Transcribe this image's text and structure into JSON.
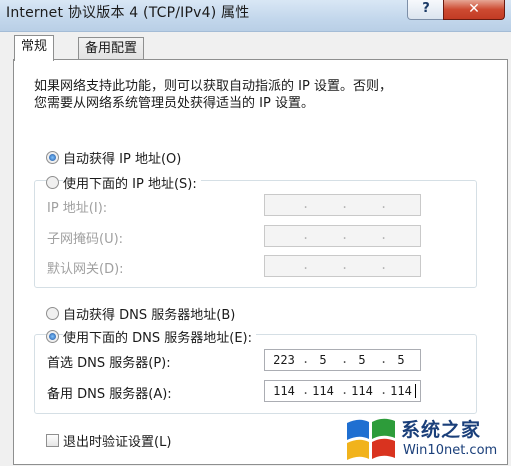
{
  "window": {
    "title": "Internet 协议版本 4 (TCP/IPv4) 属性",
    "help_label": "?",
    "close_label": "✕"
  },
  "tabs": [
    {
      "label": "常规",
      "active": true
    },
    {
      "label": "备用配置",
      "active": false
    }
  ],
  "description": {
    "line1": "如果网络支持此功能，则可以获取自动指派的 IP 设置。否则，",
    "line2": "您需要从网络系统管理员处获得适当的 IP 设置。"
  },
  "ip_section": {
    "auto_label": "自动获得 IP 地址(O)",
    "auto_selected": true,
    "manual_label": "使用下面的 IP 地址(S):",
    "manual_selected": false,
    "fields": [
      {
        "label": "IP 地址(I):"
      },
      {
        "label": "子网掩码(U):"
      },
      {
        "label": "默认网关(D):"
      }
    ]
  },
  "dns_section": {
    "auto_label": "自动获得 DNS 服务器地址(B)",
    "auto_selected": false,
    "manual_label": "使用下面的 DNS 服务器地址(E):",
    "manual_selected": true,
    "preferred": {
      "label": "首选 DNS 服务器(P):",
      "octets": [
        "223",
        "5",
        "5",
        "5"
      ]
    },
    "alternate": {
      "label": "备用 DNS 服务器(A):",
      "octets": [
        "114",
        "114",
        "114",
        "114"
      ]
    }
  },
  "validate_checkbox": {
    "label": "退出时验证设置(L)",
    "checked": false
  },
  "watermark": {
    "text1": "系统之家",
    "text2": "Win10net.com"
  },
  "colors": {
    "accent": "#1c4f9c",
    "close_button": "#c23b24",
    "titlebar": "#c3d7ec"
  }
}
